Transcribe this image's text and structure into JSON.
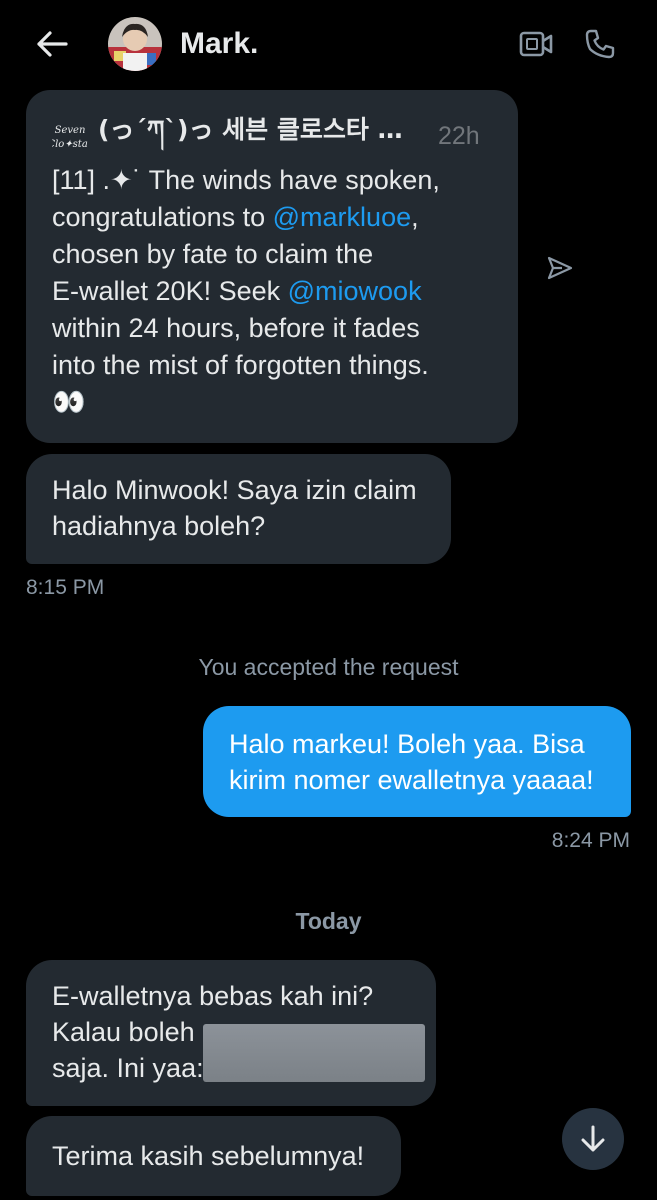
{
  "header": {
    "title": "Mark.",
    "back_icon": "arrow-left-icon",
    "video_icon": "video-camera-icon",
    "phone_icon": "phone-icon"
  },
  "shared_post": {
    "author": "(っ´ཀ`)っ 세븐 클로스타 하...",
    "time": "22h",
    "lines": [
      {
        "parts": [
          {
            "text": "[11] .✦˙ The winds have spoken,"
          }
        ]
      },
      {
        "parts": [
          {
            "text": "congratulations to "
          },
          {
            "text": "@markluoe",
            "mention": true
          },
          {
            "text": ","
          }
        ]
      },
      {
        "parts": [
          {
            "text": "chosen by fate to claim the"
          }
        ]
      },
      {
        "parts": [
          {
            "text": "E-wallet 20K! Seek "
          },
          {
            "text": "@miowook",
            "mention": true
          }
        ]
      },
      {
        "parts": [
          {
            "text": "within 24 hours, before it fades"
          }
        ]
      },
      {
        "parts": [
          {
            "text": "into the mist of forgotten things."
          }
        ]
      },
      {
        "parts": [
          {
            "text": "👀"
          }
        ]
      }
    ]
  },
  "messages": {
    "incoming_1": {
      "line1": "Halo Minwook! Saya izin claim",
      "line2": "hadiahnya boleh?",
      "time": "8:15 PM"
    },
    "system": "You accepted the request",
    "outgoing_1": {
      "line1": "Halo markeu! Boleh yaa. Bisa",
      "line2": "kirim nomer ewalletnya yaaaa!",
      "time": "8:24 PM"
    },
    "day_separator": "Today",
    "incoming_2": {
      "line1": "E-walletnya bebas kah ini?",
      "line2": "Kalau boleh",
      "line3": "saja. Ini yaa:"
    },
    "incoming_3": {
      "line1": "Terima kasih sebelumnya!"
    }
  },
  "colors": {
    "background": "#000000",
    "incoming_bubble": "#232a31",
    "outgoing_bubble": "#1d9bf0",
    "mention": "#1d9bf0",
    "muted_text": "#8b98a5"
  }
}
